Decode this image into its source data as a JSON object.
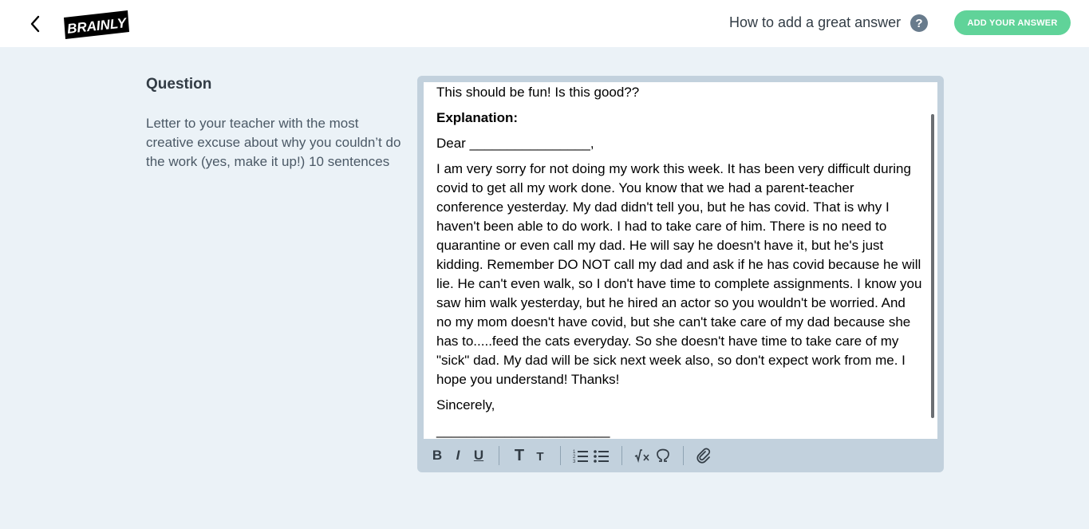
{
  "header": {
    "logo_text": "BRAINLY",
    "help_link": "How to add a great answer",
    "help_icon_label": "?",
    "add_answer_button": "ADD YOUR ANSWER",
    "icons": {
      "back": "chevron-left-icon",
      "help": "question-circle-icon"
    }
  },
  "question": {
    "heading": "Question",
    "text": "Letter to your teacher with the most creative excuse about why you couldn’t do the work (yes, make it up!) 10 sentences"
  },
  "editor": {
    "paragraphs": [
      "This should be fun! Is this good??",
      "Explanation:",
      "Dear ________________,",
      "I am very sorry for not doing my work this week. It has been very difficult during covid to get all my work done. You know that we had a parent-teacher conference yesterday. My dad didn't tell you, but he has covid. That is why I haven't been able to do work. I had to take care of him. There is no need to quarantine or even call my dad. He will say he doesn't have it, but he's just kidding. Remember DO NOT call my dad and ask if he has covid because he will lie. He can't even walk, so I don't have time to complete assignments. I know you saw him walk yesterday, but he hired an actor so you wouldn't be worried. And no my mom doesn't have covid, but she can't take care of my dad because she has to.....feed the cats everyday. So she doesn't have time to take care of my \"sick\" dad. My dad will be sick next week also, so don't expect work from me. I hope you understand! Thanks!",
      "Sincerely,",
      "_______________________"
    ],
    "toolbar": {
      "bold": "B",
      "italic": "I",
      "underline": "U",
      "heading_large": "T",
      "heading_small": "T",
      "icons": [
        "bold-icon",
        "italic-icon",
        "underline-icon",
        "heading-large-icon",
        "heading-small-icon",
        "ordered-list-icon",
        "bullet-list-icon",
        "equation-icon",
        "special-characters-icon",
        "attachment-icon"
      ]
    }
  },
  "colors": {
    "page_background": "#ebf2f7",
    "accent_green": "#60d399",
    "editor_frame": "#c2d1dd",
    "text_dark": "#323c45",
    "text_muted": "#4b5966"
  }
}
